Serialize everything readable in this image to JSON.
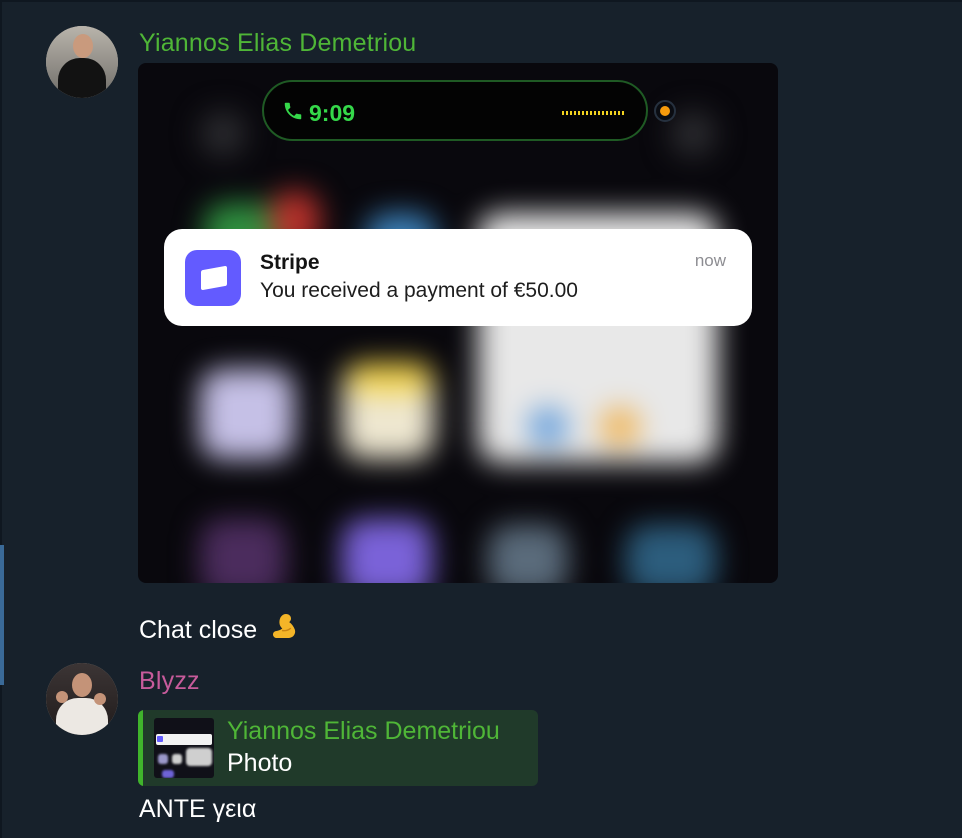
{
  "messages": [
    {
      "sender": "Yiannos Elias Demetriou",
      "sender_color": "#4fb637",
      "avatar_icon": "avatar-photo",
      "photo": {
        "status_time": "9:09",
        "status_icon": "phone-call-icon",
        "notification": {
          "app_name": "Stripe",
          "app_icon": "stripe-icon",
          "app_color": "#635bff",
          "body": "You received a payment of €50.00",
          "time": "now"
        }
      },
      "text": "Chat close",
      "text_emoji": "flexed-biceps-emoji"
    },
    {
      "sender": "Blyzz",
      "sender_color": "#c75b9b",
      "avatar_icon": "avatar-photo",
      "reply": {
        "name": "Yiannos Elias Demetriou",
        "type": "Photo",
        "accent": "#40b42c"
      },
      "text": "ΑΝΤΕ γεια"
    }
  ]
}
